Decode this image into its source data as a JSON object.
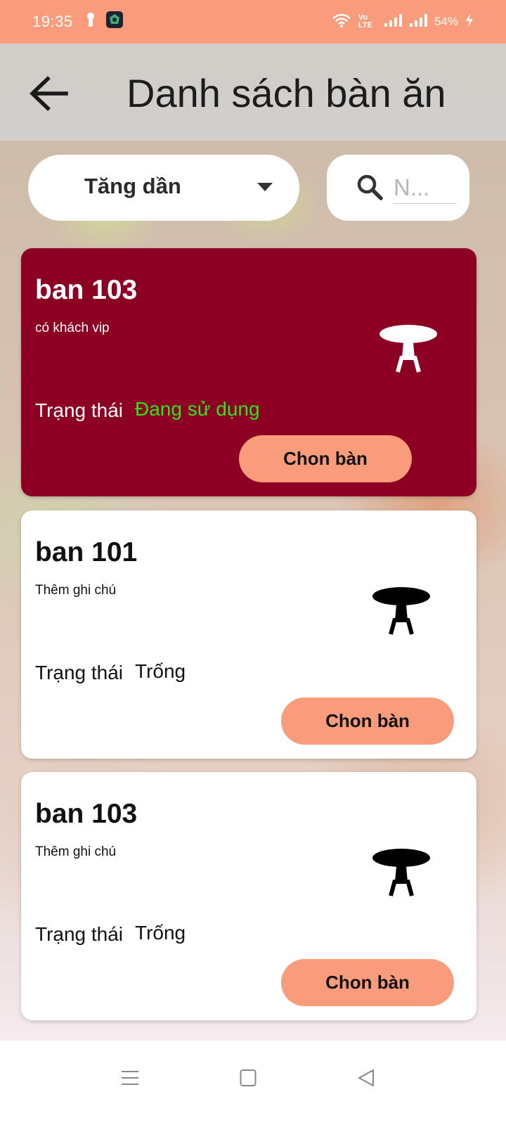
{
  "status_bar": {
    "time": "19:35",
    "network_label": "Vo LTE",
    "battery": "54%"
  },
  "header": {
    "title": "Danh sách bàn ăn"
  },
  "filters": {
    "sort_selected": "Tăng dần",
    "search_placeholder": "N..."
  },
  "tables": [
    {
      "name": "ban 103",
      "note": "có khách vip",
      "status_label": "Trạng thái",
      "status": "Đang sử dụng",
      "button": "Chon bàn"
    },
    {
      "name": "ban 101",
      "note": "Thêm ghi chú",
      "status_label": "Trạng thái",
      "status": "Trống",
      "button": "Chon bàn"
    },
    {
      "name": "ban 103",
      "note": "Thêm ghi chú",
      "status_label": "Trạng thái",
      "status": "Trống",
      "button": "Chon bàn"
    }
  ],
  "icons": {
    "back": "arrow-left-icon",
    "sort": "caret-down-icon",
    "search": "search-icon",
    "table": "dining-table-icon"
  },
  "colors": {
    "accent": "#f89c7c",
    "active_card": "#8c0023",
    "busy_status": "#2ee51c"
  }
}
